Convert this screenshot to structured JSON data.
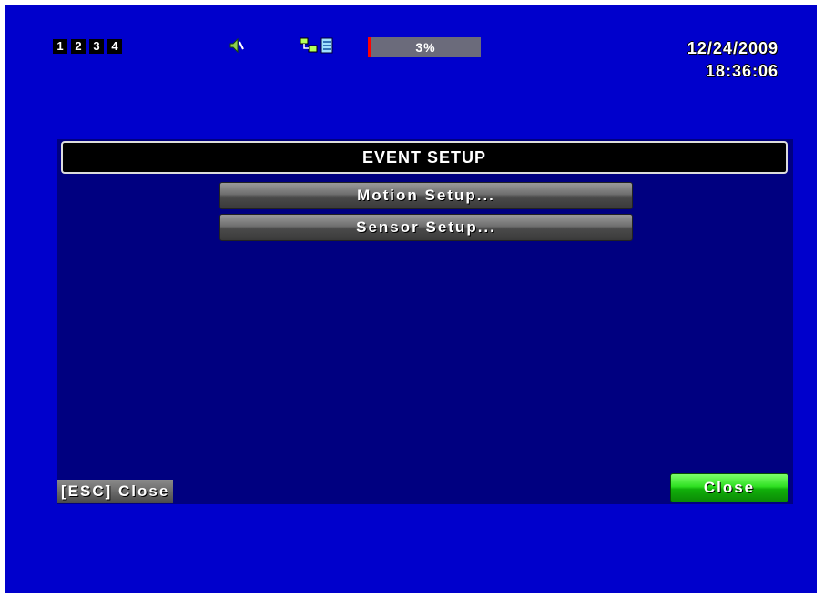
{
  "status_bar": {
    "channels": [
      "1",
      "2",
      "3",
      "4"
    ],
    "hdd_usage_text": "3%",
    "hdd_usage_percent": 3,
    "date": "12/24/2009",
    "time": "18:36:06",
    "icons": [
      "audio-icon",
      "network-icon",
      "disk-icon"
    ]
  },
  "dialog": {
    "title": "EVENT SETUP",
    "menu": {
      "motion_label": "Motion Setup...",
      "sensor_label": "Sensor Setup..."
    },
    "esc_hint": "[ESC] Close",
    "close_label": "Close"
  },
  "colors": {
    "background": "#0000cc",
    "panel": "#000080",
    "accent_green": "#22cc18",
    "hdd_marker": "#ff0000"
  }
}
